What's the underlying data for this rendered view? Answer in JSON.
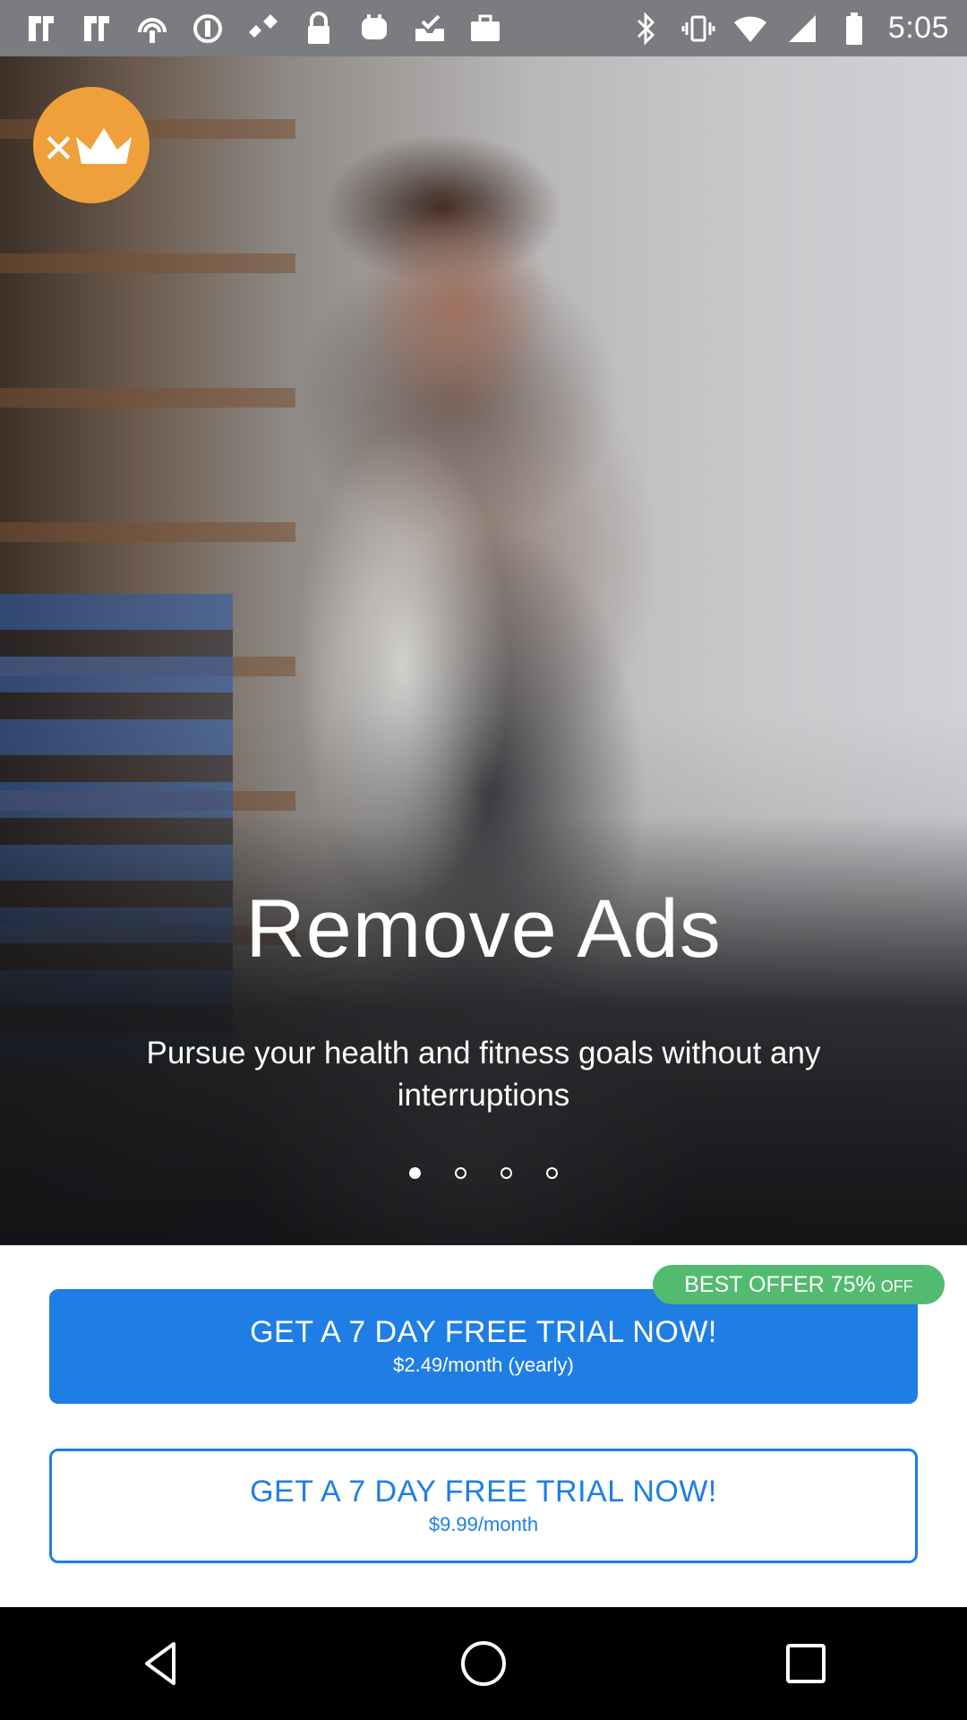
{
  "status_bar": {
    "time": "5:05",
    "left_icons": [
      "notification-icon",
      "notification-icon",
      "podcast-icon",
      "circle-icon",
      "fake-gps-icon",
      "lock-icon",
      "app-icon",
      "tray-icon",
      "briefcase-icon"
    ],
    "right_icons": [
      "bluetooth-icon",
      "vibrate-icon",
      "wifi-icon",
      "signal-icon",
      "battery-icon"
    ]
  },
  "hero": {
    "title": "Remove Ads",
    "subtitle": "Pursue your health and fitness goals without any interruptions",
    "carousel_total": 4,
    "carousel_active": 1
  },
  "offer": {
    "badge_main": "BEST OFFER 75%",
    "badge_suffix": "OFF",
    "yearly": {
      "title": "GET A 7 DAY FREE TRIAL NOW!",
      "price": "$2.49/month (yearly)"
    },
    "monthly": {
      "title": "GET A 7 DAY FREE TRIAL NOW!",
      "price": "$9.99/month"
    }
  },
  "colors": {
    "accent_blue": "#1f7ee5",
    "badge_green": "#52bb6f",
    "crown_orange": "#f0a03a"
  }
}
